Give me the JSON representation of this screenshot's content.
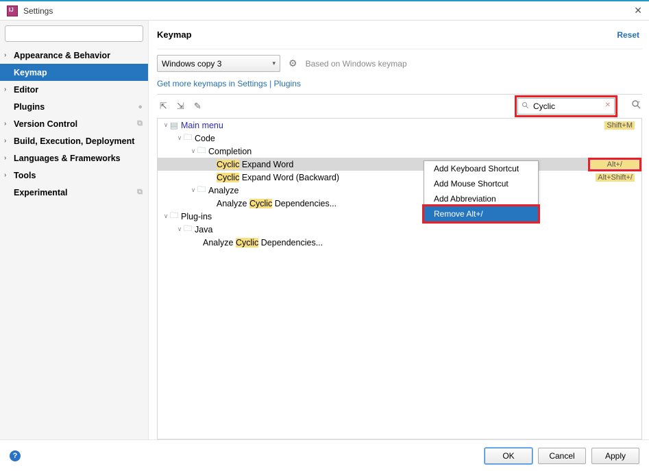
{
  "window": {
    "title": "Settings"
  },
  "sidebar": {
    "search_placeholder": "",
    "items": [
      {
        "label": "Appearance & Behavior",
        "expandable": true
      },
      {
        "label": "Keymap",
        "selected": true
      },
      {
        "label": "Editor",
        "expandable": true
      },
      {
        "label": "Plugins",
        "badge": "●"
      },
      {
        "label": "Version Control",
        "expandable": true,
        "meta": "⎘"
      },
      {
        "label": "Build, Execution, Deployment",
        "expandable": true
      },
      {
        "label": "Languages & Frameworks",
        "expandable": true
      },
      {
        "label": "Tools",
        "expandable": true
      },
      {
        "label": "Experimental",
        "meta": "⎘"
      }
    ]
  },
  "main": {
    "title": "Keymap",
    "reset": "Reset",
    "scheme_select": "Windows copy 3",
    "based_on": "Based on Windows keymap",
    "link_text": "Get more keymaps in Settings | Plugins",
    "search_value": "Cyclic",
    "tree": {
      "mainmenu": "Main menu",
      "mainmenu_shortcut": "Shift+M",
      "code": "Code",
      "completion": "Completion",
      "expand_pre": "Cyclic",
      "expand_post": " Expand Word",
      "expand_shortcut": "Alt+/",
      "expand_back_pre": "Cyclic",
      "expand_back_post": " Expand Word (Backward)",
      "expand_back_shortcut": "Alt+Shift+/",
      "analyze": "Analyze",
      "analyze_dep_pre": "Analyze ",
      "analyze_dep_mid": "Cyclic",
      "analyze_dep_post": " Dependencies...",
      "plugins": "Plug-ins",
      "java": "Java",
      "analyze_dep2_pre": "Analyze ",
      "analyze_dep2_mid": "Cyclic",
      "analyze_dep2_post": " Dependencies..."
    }
  },
  "context": {
    "items": [
      "Add Keyboard Shortcut",
      "Add Mouse Shortcut",
      "Add Abbreviation",
      "Remove Alt+/"
    ]
  },
  "footer": {
    "ok": "OK",
    "cancel": "Cancel",
    "apply": "Apply"
  }
}
